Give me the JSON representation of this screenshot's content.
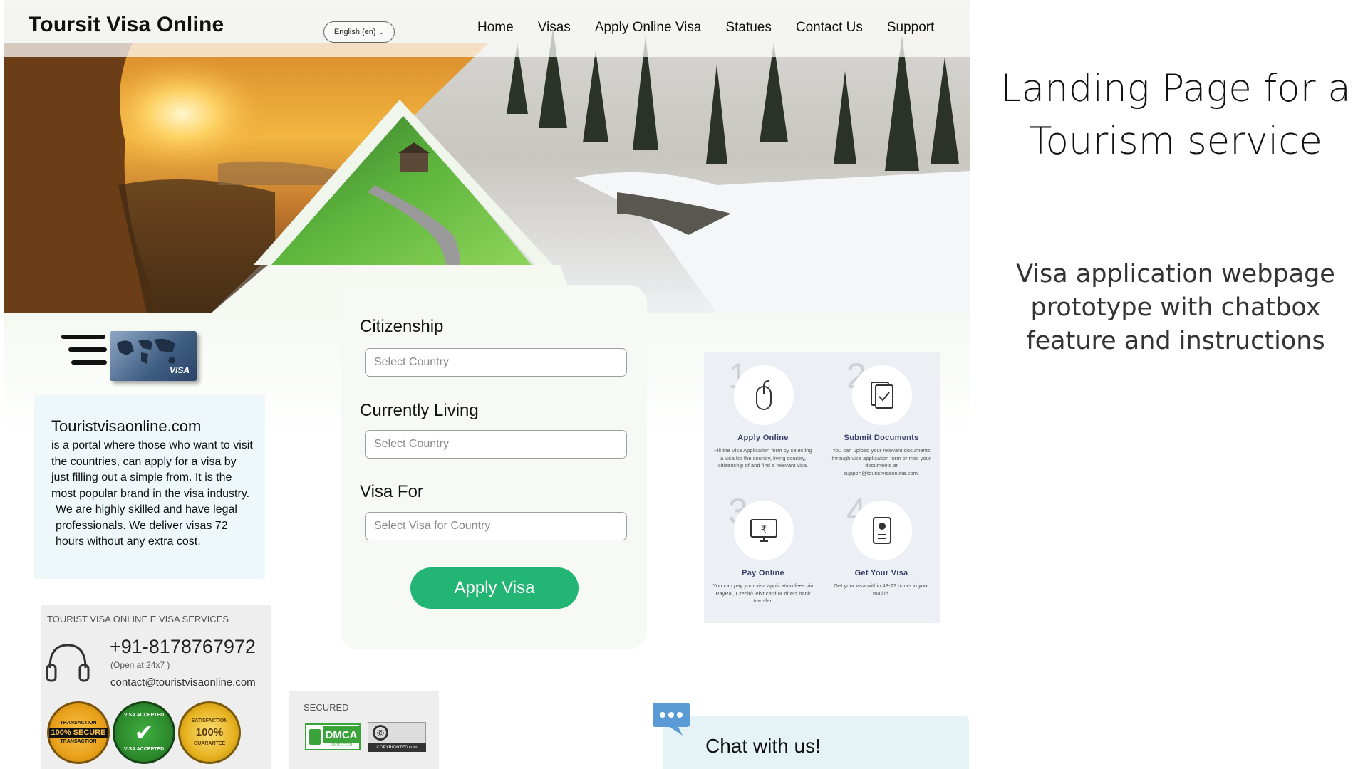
{
  "header": {
    "brand": "Toursit Visa Online",
    "language": "English (en)",
    "nav": [
      "Home",
      "Visas",
      "Apply Online Visa",
      "Statues",
      "Contact Us",
      "Support"
    ]
  },
  "form": {
    "citizenship_label": "Citizenship",
    "citizenship_placeholder": "Select Country",
    "living_label": "Currently Living",
    "living_placeholder": "Select Country",
    "visa_for_label": "Visa For",
    "visa_for_placeholder": "Select Visa for Country",
    "apply_button": "Apply Visa"
  },
  "visa_card_label": "VISA",
  "about": {
    "title": "Touristvisaonline.com",
    "text": "is a portal where those who want to visit the countries, can apply for a visa by just filling out a simple from. It is the most popular brand in the visa industry.",
    "text2": "We are highly skilled and have legal professionals. We deliver visas 72 hours without any extra cost."
  },
  "contact": {
    "title": "TOURIST VISA ONLINE E VISA SERVICES",
    "phone": "+91-8178767972",
    "hours": "(Open at 24x7 )",
    "email": "contact@touristvisaonline.com",
    "badges": [
      {
        "top": "TRANSACTION",
        "main": "100% SECURE",
        "bottom": "TRANSACTION",
        "color": "#e9a11a"
      },
      {
        "top": "VISA ACCEPTED",
        "main": "✔",
        "bottom": "VISA ACCEPTED",
        "color": "#2d8b2d"
      },
      {
        "top": "SATISFACTION",
        "main": "100%",
        "bottom": "GUARANTEE",
        "color": "#e7b21f"
      }
    ]
  },
  "secured": {
    "title": "SECURED",
    "dmca": "DMCA",
    "dmca_sub": "PROTECTED",
    "copyright_sub": "COPYRIGHTED.com"
  },
  "steps": [
    {
      "num": "1",
      "title": "Apply Online",
      "icon": "mouse-icon",
      "desc": "Fill the Visa Application form by selecting a visa for the country, living country, citizenship of and find a relevant visa."
    },
    {
      "num": "2",
      "title": "Submit Documents",
      "icon": "document-check-icon",
      "desc": "You can upload your relevant documents through visa application form or mail your documents at support@touristvisaonline.com."
    },
    {
      "num": "3",
      "title": "Pay Online",
      "icon": "monitor-rupee-icon",
      "desc": "You can pay your visa application fees via PayPal, Credit/Debit card or direct bank transfer."
    },
    {
      "num": "4",
      "title": "Get Your Visa",
      "icon": "passport-icon",
      "desc": "Get your visa within 48-72 hours in your mail id."
    }
  ],
  "chat": {
    "label": "Chat with us!"
  },
  "caption": {
    "title_line1": "Landing Page for a",
    "title_line2": "Tourism service",
    "subtitle_line1": "Visa application webpage",
    "subtitle_line2": "prototype with chatbox",
    "subtitle_line3": "feature and instructions"
  },
  "colors": {
    "accent": "#22b573",
    "steps_title": "#3a3f6b",
    "chat_bg": "#e5f3f7"
  }
}
